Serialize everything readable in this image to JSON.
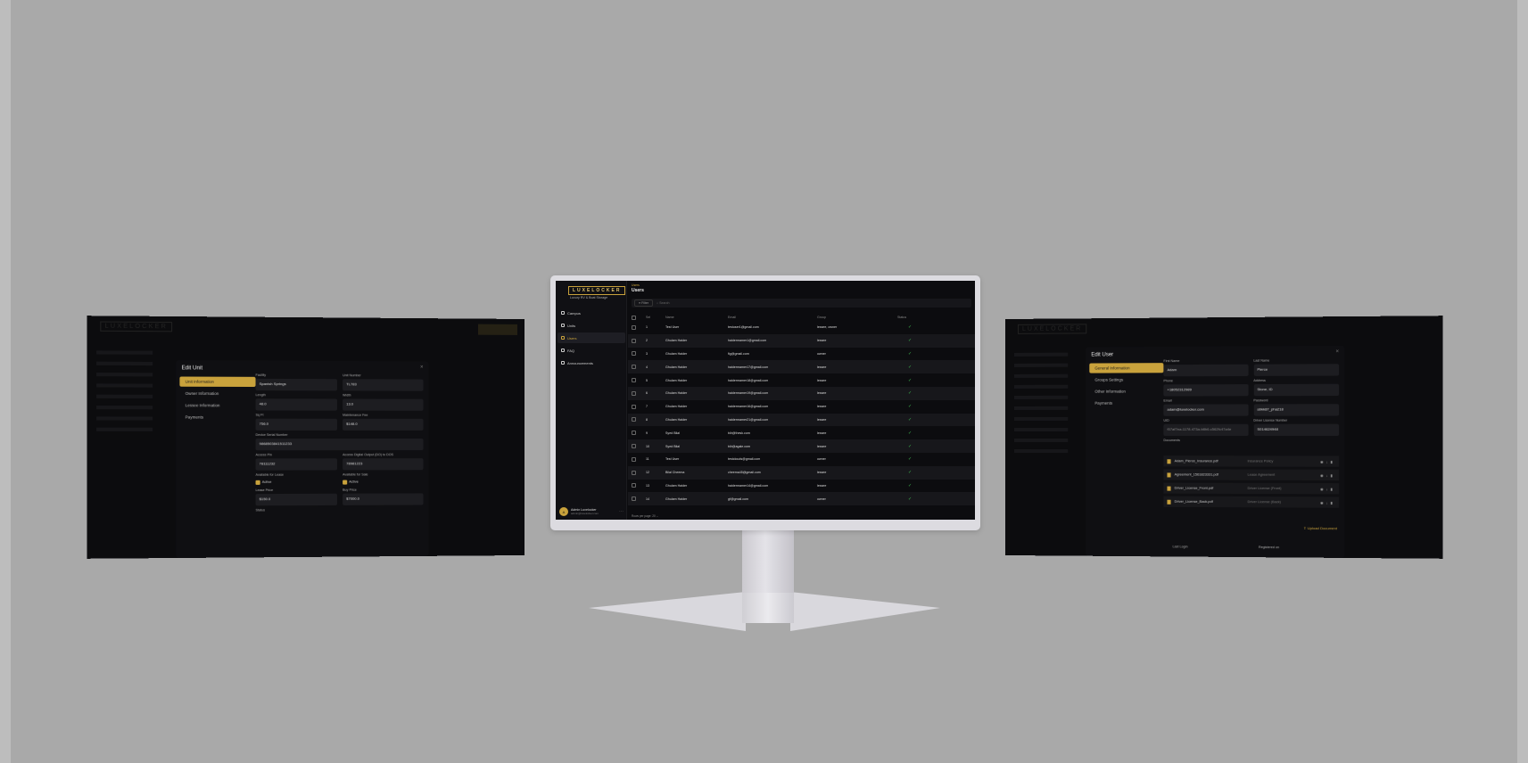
{
  "brand": {
    "logo": "LUXELOCKER",
    "tagline": "Luxury RV & Boat Storage",
    "accent": "#c9a23c"
  },
  "center": {
    "sidebar": {
      "items": [
        {
          "label": "Campus",
          "icon": "campus-icon"
        },
        {
          "label": "Units",
          "icon": "units-icon"
        },
        {
          "label": "Users",
          "icon": "users-icon",
          "active": true
        },
        {
          "label": "FAQ",
          "icon": "faq-icon"
        },
        {
          "label": "Announcements",
          "icon": "megaphone-icon"
        }
      ],
      "user": {
        "name": "Admin Luxelocker",
        "email": "admin@luxelocker.com",
        "initial": "A"
      }
    },
    "breadcrumb": "Users",
    "title": "Users",
    "filter_label": "Filter",
    "search_placeholder": "Search",
    "table": {
      "headers": [
        "Sel",
        "Name",
        "Email",
        "Group",
        "Status"
      ],
      "rows": [
        [
          "1",
          "Test User",
          "testuser1@gmail.com",
          "lessee, owner"
        ],
        [
          "2",
          "Ghulam Haider",
          "haidermamer1@gmail.com",
          "lessee"
        ],
        [
          "3",
          "Ghulam Haider",
          "fig@gmail.com",
          "owner"
        ],
        [
          "4",
          "Ghulam Haider",
          "haidermamer17@gmail.com",
          "lessee"
        ],
        [
          "5",
          "Ghulam Haider",
          "haidermamer18@gmail.com",
          "lessee"
        ],
        [
          "6",
          "Ghulam Haider",
          "haidermamer19@gmail.com",
          "lessee"
        ],
        [
          "7",
          "Ghulam Haider",
          "haidermamer16@gmail.com",
          "lessee"
        ],
        [
          "8",
          "Ghulam Haider",
          "haidermamer21@gmail.com",
          "lessee"
        ],
        [
          "9",
          "Syed Bilal",
          "bilr@thesk.com",
          "lessee"
        ],
        [
          "10",
          "Syed Bilal",
          "bilr@agale.com",
          "lessee"
        ],
        [
          "11",
          "Test User",
          "testclouds@gmail.com",
          "owner"
        ],
        [
          "12",
          "Bilal Cheema",
          "cheema45@gmail.com",
          "lessee"
        ],
        [
          "13",
          "Ghulam Haider",
          "haidermamer14@gmail.com",
          "lessee"
        ],
        [
          "14",
          "Ghulam Haider",
          "gf@gmail.com",
          "owner"
        ]
      ],
      "status_glyph": "✓"
    },
    "pager": "Rows per page:  20  ⌄"
  },
  "left": {
    "title": "Edit Unit",
    "close": "×",
    "tabs": [
      "Unit Information",
      "Owner Information",
      "Lessee Information",
      "Payments"
    ],
    "fields": [
      {
        "label": "Facility",
        "value": "Spanish Springs"
      },
      {
        "label": "Unit Number",
        "value": "TL783"
      },
      {
        "label": "Length",
        "value": "48.0"
      },
      {
        "label": "Width",
        "value": "13.0"
      },
      {
        "label": "Sq Ft",
        "value": "756.0"
      },
      {
        "label": "Maintenance Fee",
        "value": "$148.0"
      }
    ],
    "serial": {
      "label": "Device Serial Number",
      "value": "9868503841511233"
    },
    "fields2": [
      {
        "label": "Access Pin",
        "value": "78111232"
      },
      {
        "label": "Access Digital Output (DO) to DOS",
        "value": "78981223"
      }
    ],
    "lease": {
      "label": "Available for Lease",
      "check": "Active"
    },
    "sale": {
      "label": "Available for Sale",
      "check": "Active"
    },
    "fields3": [
      {
        "label": "Lease Price",
        "value": "$150.0"
      },
      {
        "label": "Buy Price",
        "value": "$7000.0"
      }
    ],
    "status_label": "Status"
  },
  "right": {
    "title": "Edit User",
    "close": "×",
    "tabs": [
      "General Information",
      "Groups Settings",
      "Other Information",
      "Payments"
    ],
    "fields": [
      {
        "label": "First Name",
        "value": "Adam"
      },
      {
        "label": "Last Name",
        "value": "Pierce"
      },
      {
        "label": "Phone",
        "value": "+18052312989"
      },
      {
        "label": "Address",
        "value": "Stone, ID"
      },
      {
        "label": "Email",
        "value": "adam@luxelocker.com"
      },
      {
        "label": "Password",
        "value": "abkk87_pha218"
      },
      {
        "label": "UID",
        "value": "f07af7ea-1178-473a-b8b6-c562fc47a4e"
      },
      {
        "label": "Driver License Number",
        "value": "S014624948"
      }
    ],
    "documents_label": "Documents",
    "documents": [
      {
        "name": "Adam_Pierce_Insurance.pdf",
        "type": "Insurance Policy"
      },
      {
        "name": "Agreement_1561823331.pdf",
        "type": "Lease Agreement"
      },
      {
        "name": "Driver_License_Front.pdf",
        "type": "Driver License (Front)"
      },
      {
        "name": "Driver_License_Back.pdf",
        "type": "Driver License (Back)"
      }
    ],
    "upload_label": "Upload Document",
    "last_login_label": "Last Login",
    "registered_label": "Registered on"
  }
}
